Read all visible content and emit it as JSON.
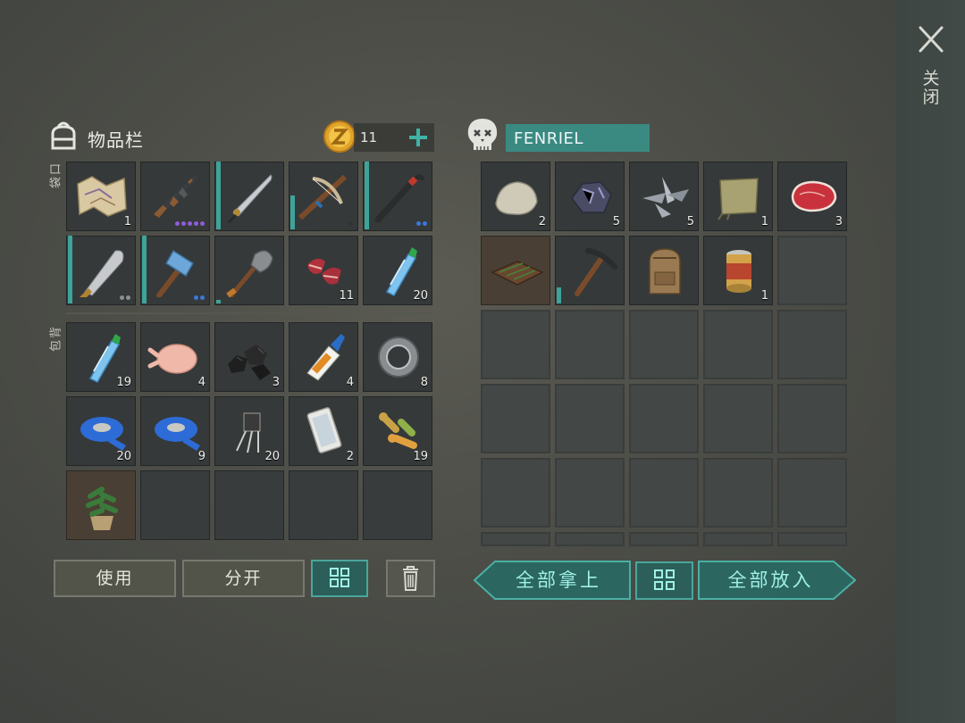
{
  "close": {
    "label_chars": [
      "关",
      "闭"
    ],
    "icon": "close-icon"
  },
  "inventory": {
    "title": "物品栏",
    "coins": "11",
    "pockets_label": [
      "口",
      "袋"
    ],
    "backpack_label": [
      "背",
      "包"
    ],
    "pockets": [
      {
        "icon": "map-icon",
        "count": "1"
      },
      {
        "icon": "assault-rifle-icon",
        "count": "",
        "dots": [
          "#8f5cd6",
          "#8f5cd6",
          "#8f5cd6",
          "#8f5cd6",
          "#8f5cd6"
        ]
      },
      {
        "icon": "katana-icon",
        "count": ""
      },
      {
        "icon": "crossbow-icon",
        "count": "",
        "dots": [
          "#333"
        ]
      },
      {
        "icon": "crowbar-icon",
        "count": "",
        "dots": [
          "#3b78d8",
          "#3b78d8"
        ]
      },
      {
        "icon": "machete-icon",
        "count": "",
        "dots": [
          "#8f8f8f",
          "#8f8f8f"
        ]
      },
      {
        "icon": "sledgehammer-icon",
        "count": "",
        "dots": [
          "#3b78d8",
          "#3b78d8"
        ]
      },
      {
        "icon": "shovel-icon",
        "count": ""
      },
      {
        "icon": "raw-meat-icon",
        "count": "11"
      },
      {
        "icon": "water-bottle-icon",
        "count": "20"
      }
    ],
    "backpack": [
      {
        "icon": "water-bottle-icon",
        "count": "19"
      },
      {
        "icon": "raw-chicken-icon",
        "count": "4"
      },
      {
        "icon": "coal-icon",
        "count": "3"
      },
      {
        "icon": "glue-icon",
        "count": "4"
      },
      {
        "icon": "bearing-icon",
        "count": "8"
      },
      {
        "icon": "tape-icon",
        "count": "20"
      },
      {
        "icon": "tape-icon",
        "count": "9"
      },
      {
        "icon": "transistor-icon",
        "count": "20"
      },
      {
        "icon": "smartphone-icon",
        "count": "2"
      },
      {
        "icon": "dog-bone-icon",
        "count": "19"
      },
      {
        "icon": "potted-plant-icon",
        "count": ""
      },
      {
        "icon": "",
        "count": ""
      },
      {
        "icon": "",
        "count": ""
      },
      {
        "icon": "",
        "count": ""
      },
      {
        "icon": "",
        "count": ""
      }
    ],
    "buttons": {
      "use": "使用",
      "split": "分开"
    }
  },
  "loot": {
    "name": "FENRIEL",
    "items": [
      {
        "icon": "stone-icon",
        "count": "2"
      },
      {
        "icon": "iron-ore-icon",
        "count": "5"
      },
      {
        "icon": "scrap-metal-icon",
        "count": "5"
      },
      {
        "icon": "cloth-icon",
        "count": "1"
      },
      {
        "icon": "steak-icon",
        "count": "3"
      },
      {
        "icon": "garden-bed-icon",
        "count": ""
      },
      {
        "icon": "pickaxe-icon",
        "count": ""
      },
      {
        "icon": "backpack-icon",
        "count": ""
      },
      {
        "icon": "canned-food-icon",
        "count": "1"
      }
    ],
    "buttons": {
      "take_all": "全部拿上",
      "put_all": "全部放入"
    }
  }
}
